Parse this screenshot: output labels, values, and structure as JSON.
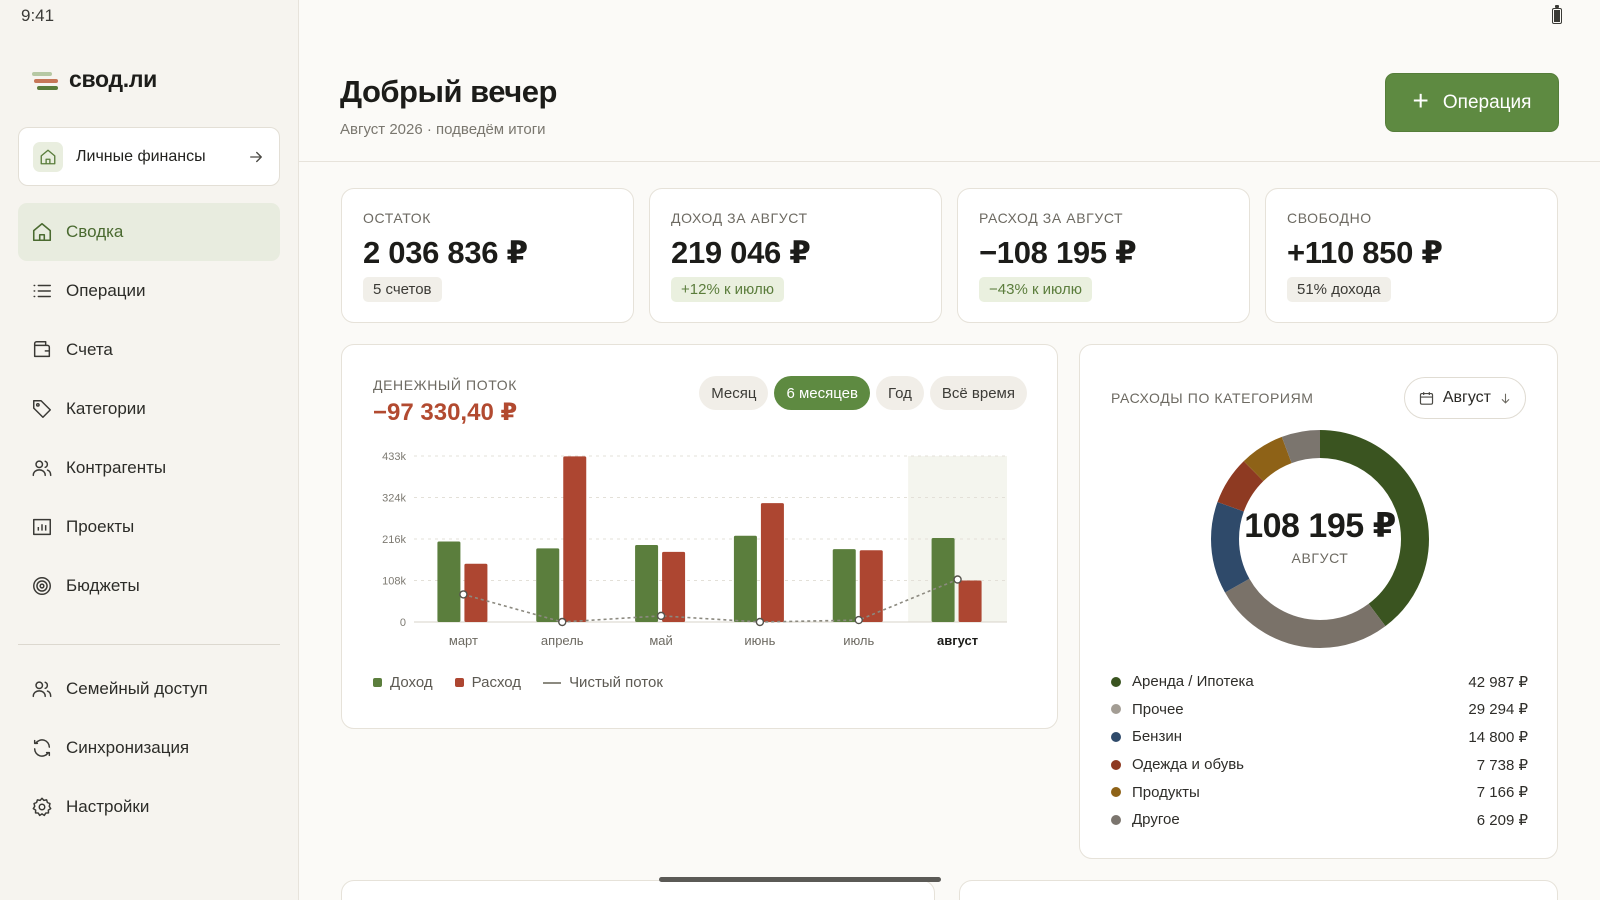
{
  "status": {
    "time": "9:41"
  },
  "brand": {
    "name": "свод.ли"
  },
  "workspace": {
    "label": "Личные финансы"
  },
  "nav": {
    "items": [
      {
        "label": "Сводка",
        "icon": "home-icon"
      },
      {
        "label": "Операции",
        "icon": "list-icon"
      },
      {
        "label": "Счета",
        "icon": "wallet-icon"
      },
      {
        "label": "Категории",
        "icon": "tag-icon"
      },
      {
        "label": "Контрагенты",
        "icon": "users-icon"
      },
      {
        "label": "Проекты",
        "icon": "folder-chart-icon"
      },
      {
        "label": "Бюджеты",
        "icon": "target-icon"
      }
    ],
    "secondary": [
      {
        "label": "Семейный доступ",
        "icon": "users-icon"
      },
      {
        "label": "Синхронизация",
        "icon": "sync-icon"
      },
      {
        "label": "Настройки",
        "icon": "gear-icon"
      }
    ]
  },
  "header": {
    "title": "Добрый вечер",
    "subtitle": "Август 2026 · подведём итоги",
    "action_label": "Операция"
  },
  "kpis": [
    {
      "label": "ОСТАТОК",
      "value": "2 036 836 ₽",
      "chip": "5 счетов"
    },
    {
      "label": "ДОХОД ЗА АВГУСТ",
      "value": "219 046 ₽",
      "chip": "+12% к июлю"
    },
    {
      "label": "РАСХОД ЗА АВГУСТ",
      "value": "−108 195 ₽",
      "chip": "−43% к июлю"
    },
    {
      "label": "СВОБОДНО",
      "value": "+110 850 ₽",
      "chip": "51% дохода"
    }
  ],
  "cashflow": {
    "label": "ДЕНЕЖНЫЙ ПОТОК",
    "value": "−97 330,40 ₽",
    "ranges": [
      "Месяц",
      "6 месяцев",
      "Год",
      "Всё время"
    ],
    "legend": {
      "income": "Доход",
      "expense": "Расход",
      "net": "Чистый поток"
    }
  },
  "chart_data": {
    "type": "bar",
    "categories": [
      "март",
      "апрель",
      "май",
      "июнь",
      "июль",
      "август"
    ],
    "highlighted_category": "август",
    "series": [
      {
        "name": "Доход",
        "values": [
          210000,
          192000,
          201000,
          225000,
          190000,
          219046
        ]
      },
      {
        "name": "Расход",
        "values": [
          152000,
          432000,
          183000,
          310000,
          187000,
          108195
        ]
      },
      {
        "name": "Чистый поток",
        "values": [
          72000,
          0,
          16000,
          0,
          5000,
          110850
        ]
      }
    ],
    "yticks": [
      "0",
      "108k",
      "216k",
      "324k",
      "433k"
    ],
    "ylim": [
      0,
      433000
    ],
    "colors": {
      "income": "#5b7e3d",
      "expense": "#ad4631",
      "net": "#8c8a80"
    }
  },
  "categories": {
    "label": "РАСХОДЫ ПО КАТЕГОРИЯМ",
    "month": "Август",
    "total": "108 195 ₽",
    "total_sub": "АВГУСТ",
    "items": [
      {
        "name": "Аренда / Ипотека",
        "value": "42 987 ₽",
        "amount": 42987,
        "color": "#3a5420"
      },
      {
        "name": "Прочее",
        "value": "29 294 ₽",
        "amount": 29294,
        "color": "#7a7269"
      },
      {
        "name": "Бензин",
        "value": "14 800 ₽",
        "amount": 14800,
        "color": "#2f4a6a"
      },
      {
        "name": "Одежда и обувь",
        "value": "7 738 ₽",
        "amount": 7738,
        "color": "#8e3a22"
      },
      {
        "name": "Продукты",
        "value": "7 166 ₽",
        "amount": 7166,
        "color": "#8e6217"
      },
      {
        "name": "Другое",
        "value": "6 209 ₽",
        "amount": 6209,
        "color": "#7b756e"
      }
    ],
    "legend_dot_colors": [
      "#3a5420",
      "#a39d94",
      "#2f4a6a",
      "#8e3a22",
      "#8e6217",
      "#7b756e"
    ]
  }
}
